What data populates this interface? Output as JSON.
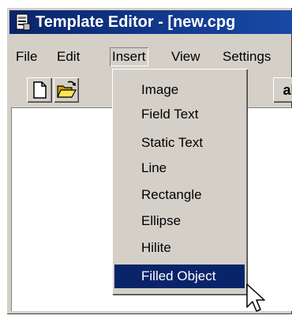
{
  "window": {
    "title": "Template Editor - [new.cpg",
    "title_bar_color": "#0a246a"
  },
  "menubar": {
    "items": [
      "File",
      "Edit",
      "Insert",
      "View",
      "Settings"
    ],
    "open_item": "Insert"
  },
  "toolbar": {
    "buttons": [
      "new-document-icon",
      "open-folder-icon"
    ],
    "partial_label": "al"
  },
  "insert_menu": {
    "items": [
      "Image",
      "Field Text",
      "Static Text",
      "Line",
      "Rectangle",
      "Ellipse",
      "Hilite",
      "Filled Object"
    ],
    "selected": "Filled Object",
    "highlight_color": "#0a246a"
  }
}
